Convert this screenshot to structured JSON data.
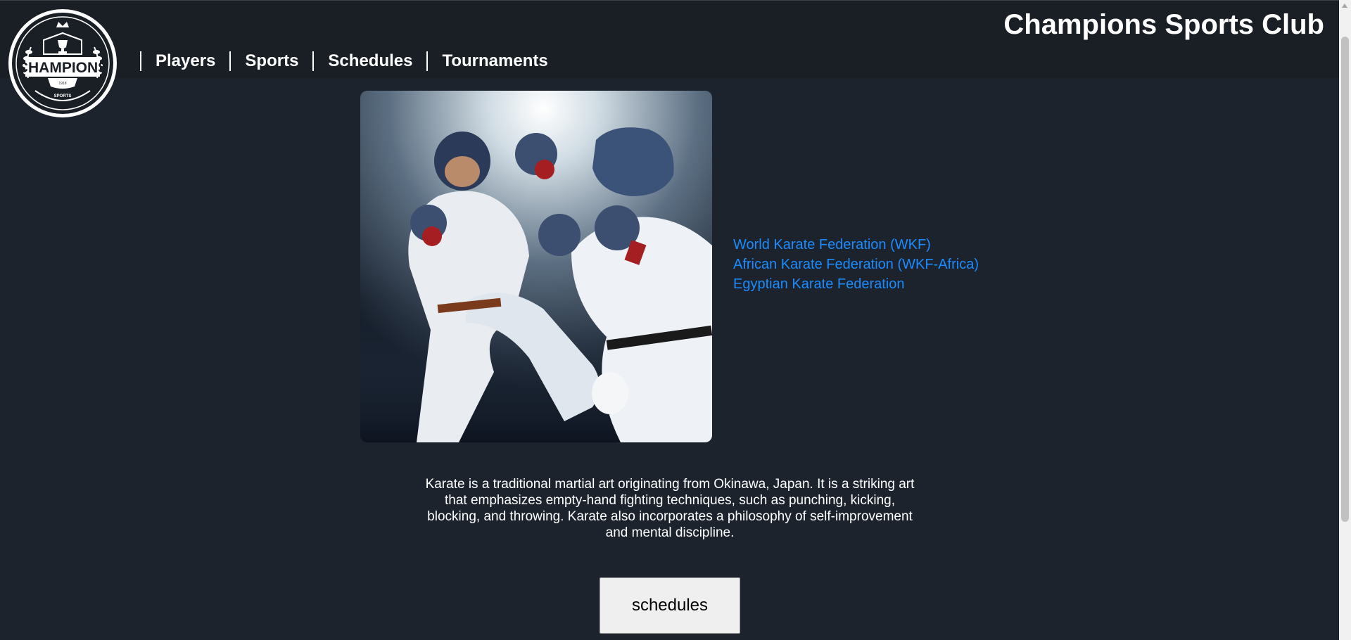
{
  "header": {
    "site_title": "Champions Sports Club",
    "logo": {
      "text": "CHAMPIONS",
      "sub_text": "SPORTS",
      "year": "1918"
    }
  },
  "nav": {
    "items": [
      {
        "label": "Players"
      },
      {
        "label": "Sports"
      },
      {
        "label": "Schedules"
      },
      {
        "label": "Tournaments"
      }
    ]
  },
  "main": {
    "image_alt": "Two karate fighters in white gi sparring with headgear and gloves",
    "federation_links": [
      {
        "label": "World Karate Federation (WKF)"
      },
      {
        "label": "African Karate Federation (WKF-Africa)"
      },
      {
        "label": "Egyptian Karate Federation"
      }
    ],
    "description": "Karate is a traditional martial art originating from Okinawa, Japan. It is a striking art that emphasizes empty-hand fighting techniques, such as punching, kicking, blocking, and throwing. Karate also incorporates a philosophy of self-improvement and mental discipline.",
    "schedules_button": "schedules"
  },
  "colors": {
    "page_bg": "#1c232d",
    "header_bg": "#1a1f25",
    "link": "#1a8cff",
    "text": "#ffffff",
    "button_bg": "#efefef"
  }
}
